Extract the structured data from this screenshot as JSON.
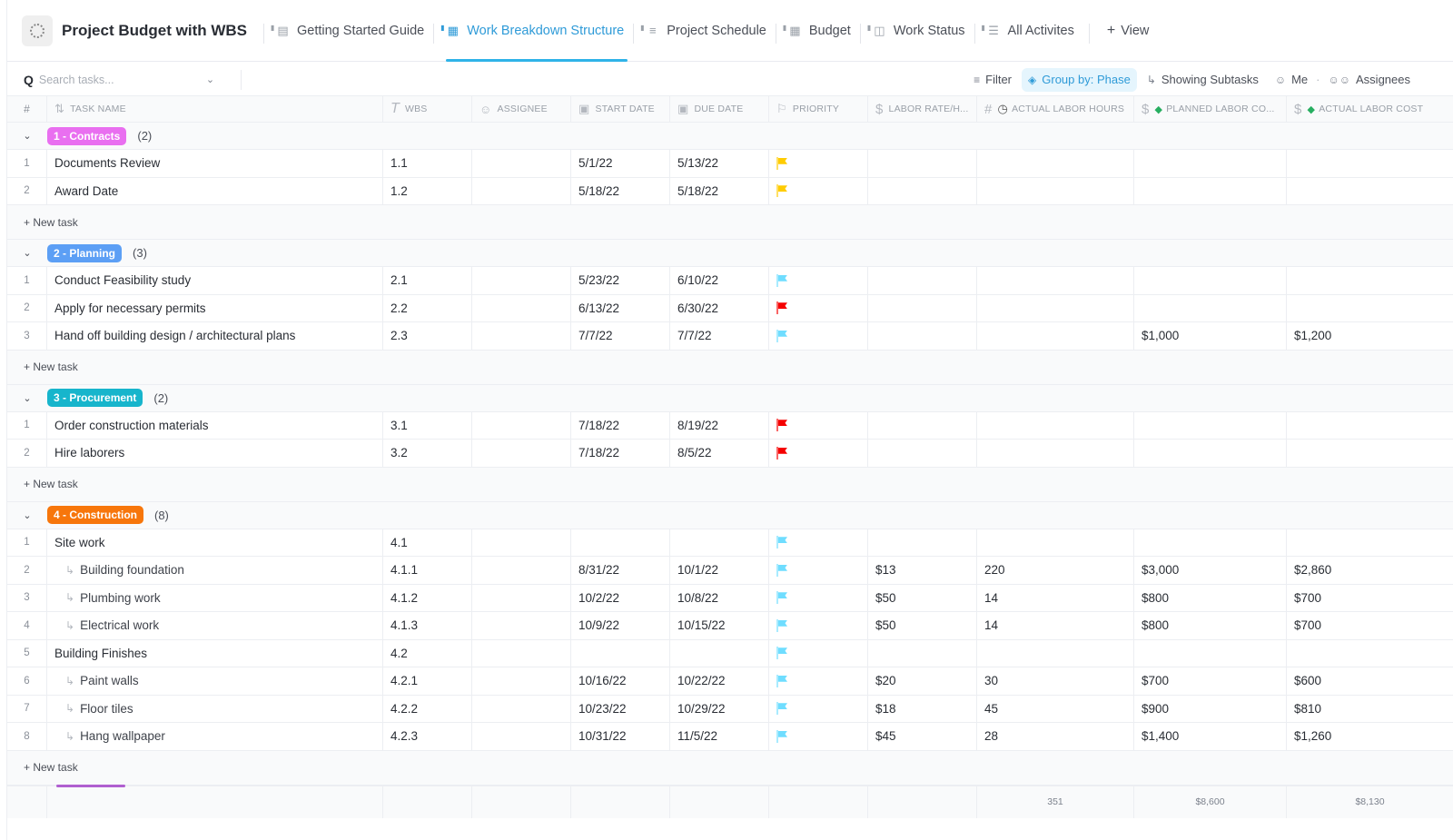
{
  "header": {
    "space_icon": "space-spinner-icon",
    "title": "Project Budget with WBS",
    "tabs": [
      {
        "label": "Getting Started Guide",
        "icon": "doc-icon",
        "active": false
      },
      {
        "label": "Work Breakdown Structure",
        "icon": "table-icon",
        "active": true
      },
      {
        "label": "Project Schedule",
        "icon": "gantt-icon",
        "active": false
      },
      {
        "label": "Budget",
        "icon": "table-icon",
        "active": false
      },
      {
        "label": "Work Status",
        "icon": "board-icon",
        "active": false
      },
      {
        "label": "All Activites",
        "icon": "list-icon",
        "active": false
      }
    ],
    "add_view_label": "View"
  },
  "toolbar": {
    "search_placeholder": "Search tasks...",
    "filter_label": "Filter",
    "group_by_label": "Group by: Phase",
    "subtasks_label": "Showing Subtasks",
    "me_label": "Me",
    "assignees_label": "Assignees"
  },
  "columns": {
    "num": "#",
    "name": "Task Name",
    "wbs": "WBS",
    "assignee": "Assignee",
    "start": "Start Date",
    "due": "Due Date",
    "priority": "Priority",
    "rate": "Labor Rate/H...",
    "hours": "Actual Labor Hours",
    "planned": "Planned Labor Co...",
    "actual": "Actual Labor Cost"
  },
  "colors": {
    "accent": "#2f9bd8",
    "priority_urgent": "#f50000",
    "priority_high": "#ffcc00",
    "priority_normal": "#6fddff"
  },
  "new_task_label": "+ New task",
  "groups": [
    {
      "label": "1 - Contracts",
      "count": "(2)",
      "color": "#e96ff0",
      "tasks": [
        {
          "num": "1",
          "name": "Documents Review",
          "subtask": false,
          "wbs": "1.1",
          "start": "5/1/22",
          "due": "5/13/22",
          "priority": "high",
          "rate": "",
          "hours": "",
          "planned": "",
          "actual": ""
        },
        {
          "num": "2",
          "name": "Award Date",
          "subtask": false,
          "wbs": "1.2",
          "start": "5/18/22",
          "due": "5/18/22",
          "priority": "high",
          "rate": "",
          "hours": "",
          "planned": "",
          "actual": ""
        }
      ]
    },
    {
      "label": "2 - Planning",
      "count": "(3)",
      "color": "#5c9ff5",
      "tasks": [
        {
          "num": "1",
          "name": "Conduct Feasibility study",
          "subtask": false,
          "wbs": "2.1",
          "start": "5/23/22",
          "due": "6/10/22",
          "priority": "normal",
          "rate": "",
          "hours": "",
          "planned": "",
          "actual": ""
        },
        {
          "num": "2",
          "name": "Apply for necessary permits",
          "subtask": false,
          "wbs": "2.2",
          "start": "6/13/22",
          "due": "6/30/22",
          "priority": "urgent",
          "rate": "",
          "hours": "",
          "planned": "",
          "actual": ""
        },
        {
          "num": "3",
          "name": "Hand off building design / architectural plans",
          "subtask": false,
          "wbs": "2.3",
          "start": "7/7/22",
          "due": "7/7/22",
          "priority": "normal",
          "rate": "",
          "hours": "",
          "planned": "$1,000",
          "actual": "$1,200"
        }
      ]
    },
    {
      "label": "3 - Procurement",
      "count": "(2)",
      "color": "#17b5cc",
      "tasks": [
        {
          "num": "1",
          "name": "Order construction materials",
          "subtask": false,
          "wbs": "3.1",
          "start": "7/18/22",
          "due": "8/19/22",
          "priority": "urgent",
          "rate": "",
          "hours": "",
          "planned": "",
          "actual": ""
        },
        {
          "num": "2",
          "name": "Hire laborers",
          "subtask": false,
          "wbs": "3.2",
          "start": "7/18/22",
          "due": "8/5/22",
          "priority": "urgent",
          "rate": "",
          "hours": "",
          "planned": "",
          "actual": ""
        }
      ]
    },
    {
      "label": "4 - Construction",
      "count": "(8)",
      "color": "#f7760b",
      "tasks": [
        {
          "num": "1",
          "name": "Site work",
          "subtask": false,
          "wbs": "4.1",
          "start": "",
          "due": "",
          "priority": "normal",
          "rate": "",
          "hours": "",
          "planned": "",
          "actual": ""
        },
        {
          "num": "2",
          "name": "Building foundation",
          "subtask": true,
          "wbs": "4.1.1",
          "start": "8/31/22",
          "due": "10/1/22",
          "priority": "normal",
          "rate": "$13",
          "hours": "220",
          "planned": "$3,000",
          "actual": "$2,860"
        },
        {
          "num": "3",
          "name": "Plumbing work",
          "subtask": true,
          "wbs": "4.1.2",
          "start": "10/2/22",
          "due": "10/8/22",
          "priority": "normal",
          "rate": "$50",
          "hours": "14",
          "planned": "$800",
          "actual": "$700"
        },
        {
          "num": "4",
          "name": "Electrical work",
          "subtask": true,
          "wbs": "4.1.3",
          "start": "10/9/22",
          "due": "10/15/22",
          "priority": "normal",
          "rate": "$50",
          "hours": "14",
          "planned": "$800",
          "actual": "$700"
        },
        {
          "num": "5",
          "name": "Building Finishes",
          "subtask": false,
          "wbs": "4.2",
          "start": "",
          "due": "",
          "priority": "normal",
          "rate": "",
          "hours": "",
          "planned": "",
          "actual": ""
        },
        {
          "num": "6",
          "name": "Paint walls",
          "subtask": true,
          "wbs": "4.2.1",
          "start": "10/16/22",
          "due": "10/22/22",
          "priority": "normal",
          "rate": "$20",
          "hours": "30",
          "planned": "$700",
          "actual": "$600"
        },
        {
          "num": "7",
          "name": "Floor tiles",
          "subtask": true,
          "wbs": "4.2.2",
          "start": "10/23/22",
          "due": "10/29/22",
          "priority": "normal",
          "rate": "$18",
          "hours": "45",
          "planned": "$900",
          "actual": "$810"
        },
        {
          "num": "8",
          "name": "Hang wallpaper",
          "subtask": true,
          "wbs": "4.2.3",
          "start": "10/31/22",
          "due": "11/5/22",
          "priority": "normal",
          "rate": "$45",
          "hours": "28",
          "planned": "$1,400",
          "actual": "$1,260"
        }
      ]
    }
  ],
  "totals": {
    "hours": "351",
    "planned": "$8,600",
    "actual": "$8,130"
  }
}
